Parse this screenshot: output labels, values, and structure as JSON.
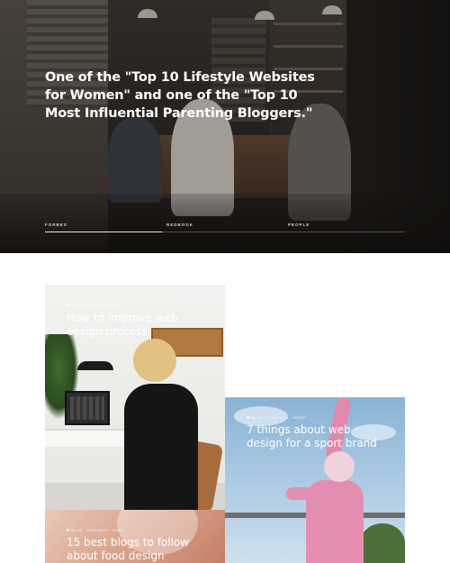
{
  "hero": {
    "quote": "One of the \"Top 10 Lifestyle Websites for Women\" and one of the \"Top 10 Most Influential Parenting Bloggers.\"",
    "press": [
      "FORBES",
      "REDBOOK",
      "PEOPLE"
    ]
  },
  "cards": [
    {
      "meta": "BLOG · 12/11/2019 · WEB",
      "title": "How to improve web design process",
      "image_icon": "office-photo"
    },
    {
      "meta": "BLOG · 12/11/2019 · SPORT",
      "title": "7 things about web design for a sport brand",
      "image_icon": "sport-photo"
    },
    {
      "meta": "BLOG · 12/11/2019 · FOOD",
      "title": "15 best blogs to follow about food design",
      "image_icon": "food-photo"
    }
  ]
}
